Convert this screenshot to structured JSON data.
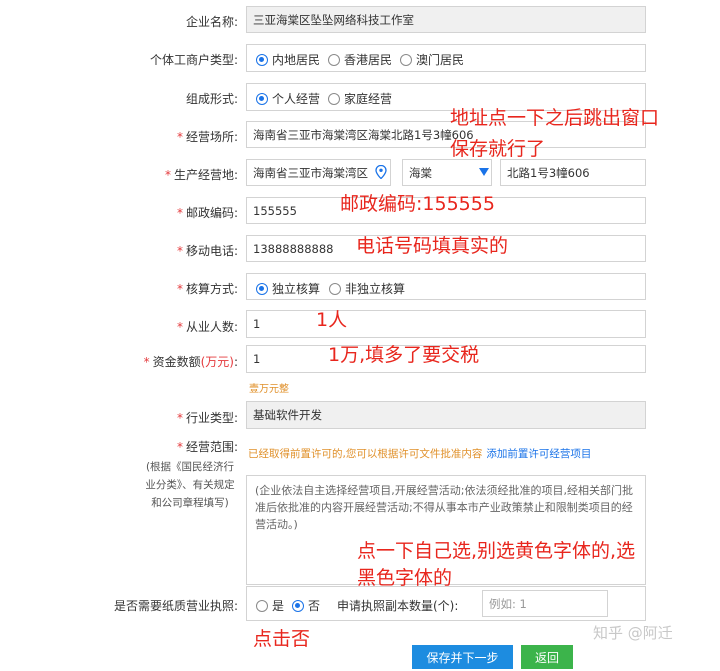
{
  "form": {
    "company_name": {
      "label": "企业名称:",
      "value": "三亚海棠区坠坠网络科技工作室"
    },
    "merchant_type": {
      "label": "个体工商户类型:",
      "options": [
        "内地居民",
        "香港居民",
        "澳门居民"
      ],
      "selected": "内地居民"
    },
    "org_form": {
      "label": "组成形式:",
      "options": [
        "个人经营",
        "家庭经营"
      ],
      "selected": "个人经营"
    },
    "business_address": {
      "label": "经营场所:",
      "value": "海南省三亚市海棠湾区海棠北路1号3幢606"
    },
    "production_address": {
      "label": "生产经营地:",
      "region": "海南省三亚市海棠湾区",
      "district": "海棠",
      "street": "北路1号3幢606"
    },
    "postcode": {
      "label": "邮政编码:",
      "value": "155555"
    },
    "phone": {
      "label": "移动电话:",
      "value": "13888888888"
    },
    "accounting": {
      "label": "核算方式:",
      "options": [
        "独立核算",
        "非独立核算"
      ],
      "selected": "独立核算"
    },
    "employees": {
      "label": "从业人数:",
      "value": "1"
    },
    "capital": {
      "label": "资金数额",
      "unit": "(万元)",
      "colon": ":",
      "value": "1",
      "in_words": "壹万元整"
    },
    "industry": {
      "label": "行业类型:",
      "value": "基础软件开发"
    },
    "scope": {
      "label": "经营范围:",
      "note_lines": [
        "(根据《国民经济行",
        "业分类》、有关规定",
        "和公司章程填写)"
      ],
      "hint": "已经取得前置许可的,您可以根据许可文件批准内容",
      "hint_link": "添加前置许可经营项目",
      "placeholder": "(企业依法自主选择经营项目,开展经营活动;依法须经批准的项目,经相关部门批准后依批准的内容开展经营活动;不得从事本市产业政策禁止和限制类项目的经营活动。)"
    },
    "paper_license": {
      "label": "是否需要纸质营业执照:",
      "options": [
        "是",
        "否"
      ],
      "selected": "否",
      "copies_label": "申请执照副本数量(个):",
      "copies_placeholder": "例如: 1"
    }
  },
  "buttons": {
    "save_next": "保存并下一步",
    "back": "返回"
  },
  "annotations": {
    "address_line1": "地址点一下之后跳出窗口",
    "address_line2": "保存就行了",
    "postcode": "邮政编码:155555",
    "phone": "电话号码填真实的",
    "employees": "1人",
    "capital": "1万,填多了要交税",
    "scope_line1": "点一下自己选,别选黄色字体的,选",
    "scope_line2": "黑色字体的",
    "paper": "点击否"
  },
  "watermark": "知乎 @阿迁",
  "colors": {
    "accent": "#1a73e8",
    "required": "#e4393c",
    "annotation": "#e8261d",
    "hint": "#e0902a",
    "save_button": "#1d8ce0",
    "back_button": "#3cb44b"
  }
}
